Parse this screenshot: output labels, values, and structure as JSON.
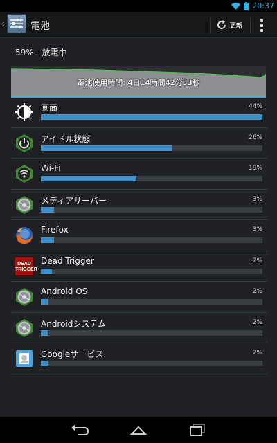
{
  "status_bar": {
    "time": "20:37"
  },
  "action_bar": {
    "back": "‹",
    "title": "電池",
    "refresh_label": "更新"
  },
  "battery": {
    "summary": "59% - 放電中",
    "graph_label": "電池使用時間: 4日14時間42分53秒"
  },
  "colors": {
    "accent": "#33b5e5",
    "bar": "#3c8fc8",
    "graph_line": "#4fbf4f"
  },
  "usage": [
    {
      "name": "画面",
      "percent": "44%",
      "level": 100,
      "icon": "brightness-icon"
    },
    {
      "name": "アイドル状態",
      "percent": "26%",
      "level": 59,
      "icon": "power-icon"
    },
    {
      "name": "Wi-Fi",
      "percent": "19%",
      "level": 43,
      "icon": "wifi-icon"
    },
    {
      "name": "メディアサーバー",
      "percent": "3%",
      "level": 6,
      "icon": "android-gear-icon"
    },
    {
      "name": "Firefox",
      "percent": "3%",
      "level": 6,
      "icon": "firefox-icon"
    },
    {
      "name": "Dead Trigger",
      "percent": "2%",
      "level": 5,
      "icon": "dead-trigger-icon",
      "icon_text": "DEAD TRIGGER"
    },
    {
      "name": "Android OS",
      "percent": "2%",
      "level": 3,
      "icon": "android-gear-icon"
    },
    {
      "name": "Androidシステム",
      "percent": "2%",
      "level": 3,
      "icon": "android-gear-icon"
    },
    {
      "name": "Googleサービス",
      "percent": "2%",
      "level": 3,
      "icon": "google-services-icon"
    }
  ]
}
